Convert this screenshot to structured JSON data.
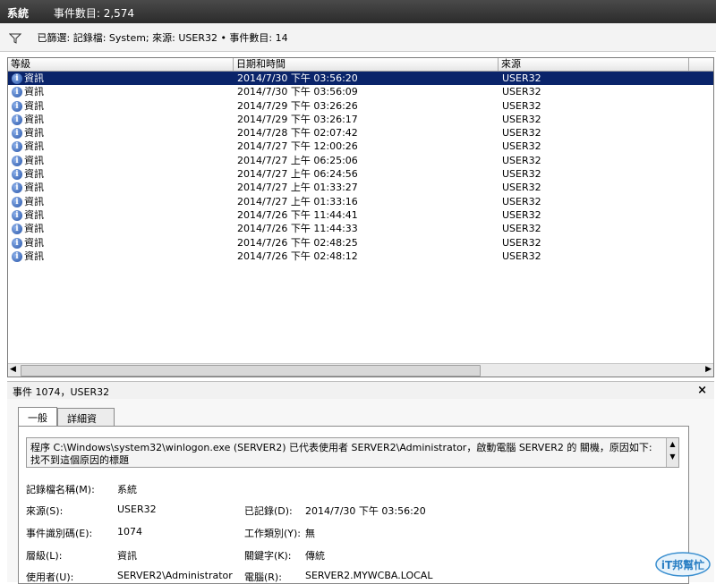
{
  "title": {
    "name": "系統",
    "count": "事件數目: 2,574"
  },
  "filter": {
    "text": "已篩選: 記錄檔: System; 來源: USER32 • 事件數目: 14"
  },
  "columns": {
    "level": "等級",
    "datetime": "日期和時間",
    "source": "來源"
  },
  "events": [
    {
      "level": "資訊",
      "datetime": "2014/7/30 下午 03:56:20",
      "source": "USER32"
    },
    {
      "level": "資訊",
      "datetime": "2014/7/30 下午 03:56:09",
      "source": "USER32"
    },
    {
      "level": "資訊",
      "datetime": "2014/7/29 下午 03:26:26",
      "source": "USER32"
    },
    {
      "level": "資訊",
      "datetime": "2014/7/29 下午 03:26:17",
      "source": "USER32"
    },
    {
      "level": "資訊",
      "datetime": "2014/7/28 下午 02:07:42",
      "source": "USER32"
    },
    {
      "level": "資訊",
      "datetime": "2014/7/27 下午 12:00:26",
      "source": "USER32"
    },
    {
      "level": "資訊",
      "datetime": "2014/7/27 上午 06:25:06",
      "source": "USER32"
    },
    {
      "level": "資訊",
      "datetime": "2014/7/27 上午 06:24:56",
      "source": "USER32"
    },
    {
      "level": "資訊",
      "datetime": "2014/7/27 上午 01:33:27",
      "source": "USER32"
    },
    {
      "level": "資訊",
      "datetime": "2014/7/27 上午 01:33:16",
      "source": "USER32"
    },
    {
      "level": "資訊",
      "datetime": "2014/7/26 下午 11:44:41",
      "source": "USER32"
    },
    {
      "level": "資訊",
      "datetime": "2014/7/26 下午 11:44:33",
      "source": "USER32"
    },
    {
      "level": "資訊",
      "datetime": "2014/7/26 下午 02:48:25",
      "source": "USER32"
    },
    {
      "level": "資訊",
      "datetime": "2014/7/26 下午 02:48:12",
      "source": "USER32"
    }
  ],
  "detail": {
    "header": "事件 1074，USER32",
    "close": "×",
    "tabs": {
      "general": "一般",
      "details": "詳細資料"
    },
    "message": "程序 C:\\Windows\\system32\\winlogon.exe (SERVER2) 已代表使用者 SERVER2\\Administrator，啟動電腦 SERVER2 的 關機，原因如下: 找不到這個原因的標題",
    "fields": {
      "log_name_label": "記錄檔名稱(M):",
      "log_name": "系統",
      "source_label": "來源(S):",
      "source": "USER32",
      "logged_label": "已記錄(D):",
      "logged": "2014/7/30 下午 03:56:20",
      "event_id_label": "事件識別碼(E):",
      "event_id": "1074",
      "task_label": "工作類別(Y):",
      "task": "無",
      "level_label": "層級(L):",
      "level": "資訊",
      "keywords_label": "關鍵字(K):",
      "keywords": "傳統",
      "user_label": "使用者(U):",
      "user": "SERVER2\\Administrator",
      "computer_label": "電腦(R):",
      "computer": "SERVER2.MYWCBA.LOCAL"
    }
  },
  "watermark": "iT邦幫忙",
  "colors": {
    "selection": "#0a246a",
    "titlebar": "#333333"
  }
}
